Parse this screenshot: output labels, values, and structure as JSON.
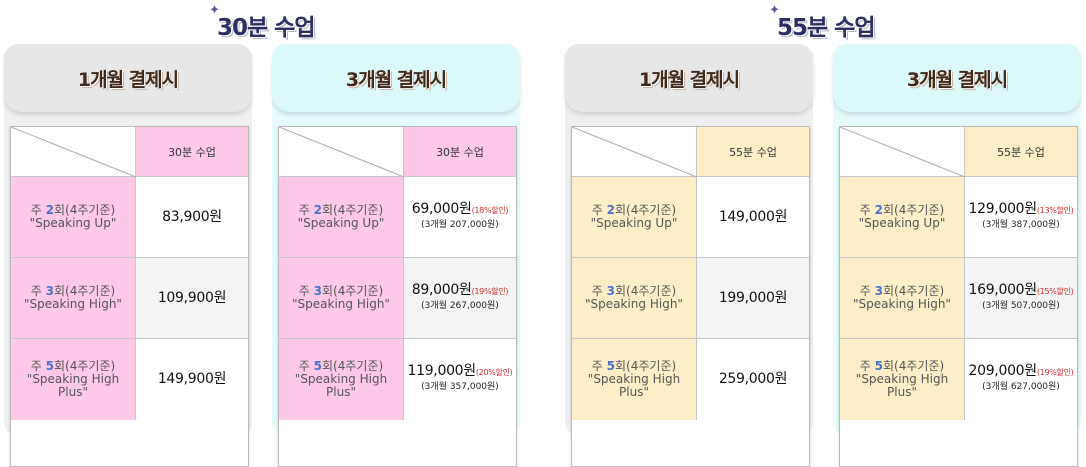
{
  "colors": {
    "title": "#2c2f62",
    "pink": "#fcc9e6",
    "yellow": "#fdeec9",
    "gray_card": "#efefef",
    "cyan_card": "#e6fbfb",
    "discount": "#d23030",
    "number": "#4a73c9"
  },
  "titles": {
    "left": "30분 수업",
    "right": "55분 수업"
  },
  "cards": [
    {
      "head": "1개월 결제시",
      "col_label": "30분 수업",
      "rows": [
        {
          "pre": "주 ",
          "num": "2",
          "post": "회(4주기준)",
          "plan": "\"Speaking Up\"",
          "price": "83,900원",
          "disc": "",
          "sub": ""
        },
        {
          "pre": "주 ",
          "num": "3",
          "post": "회(4주기준)",
          "plan": "\"Speaking High\"",
          "price": "109,900원",
          "disc": "",
          "sub": ""
        },
        {
          "pre": "주 ",
          "num": "5",
          "post": "회(4주기준)",
          "plan": "\"Speaking High Plus\"",
          "price": "149,900원",
          "disc": "",
          "sub": ""
        }
      ]
    },
    {
      "head": "3개월 결제시",
      "col_label": "30분 수업",
      "rows": [
        {
          "pre": "주 ",
          "num": "2",
          "post": "회(4주기준)",
          "plan": "\"Speaking Up\"",
          "price": "69,000원",
          "disc": "(18%할인)",
          "sub": "(3개월 207,000원)"
        },
        {
          "pre": "주 ",
          "num": "3",
          "post": "회(4주기준)",
          "plan": "\"Speaking High\"",
          "price": "89,000원",
          "disc": "(19%할인)",
          "sub": "(3개월 267,000원)"
        },
        {
          "pre": "주 ",
          "num": "5",
          "post": "회(4주기준)",
          "plan": "\"Speaking High Plus\"",
          "price": "119,000원",
          "disc": "(20%할인)",
          "sub": "(3개월 357,000원)"
        }
      ]
    },
    {
      "head": "1개월 결제시",
      "col_label": "55분 수업",
      "rows": [
        {
          "pre": "주 ",
          "num": "2",
          "post": "회(4주기준)",
          "plan": "\"Speaking Up\"",
          "price": "149,000원",
          "disc": "",
          "sub": ""
        },
        {
          "pre": "주 ",
          "num": "3",
          "post": "회(4주기준)",
          "plan": "\"Speaking High\"",
          "price": "199,000원",
          "disc": "",
          "sub": ""
        },
        {
          "pre": "주 ",
          "num": "5",
          "post": "회(4주기준)",
          "plan": "\"Speaking High Plus\"",
          "price": "259,000원",
          "disc": "",
          "sub": ""
        }
      ]
    },
    {
      "head": "3개월 결제시",
      "col_label": "55분 수업",
      "rows": [
        {
          "pre": "주 ",
          "num": "2",
          "post": "회(4주기준)",
          "plan": "\"Speaking Up\"",
          "price": "129,000원",
          "disc": "(13%할인)",
          "sub": "(3개월 387,000원)"
        },
        {
          "pre": "주 ",
          "num": "3",
          "post": "회(4주기준)",
          "plan": "\"Speaking High\"",
          "price": "169,000원",
          "disc": "(15%할인)",
          "sub": "(3개월 507,000원)"
        },
        {
          "pre": "주 ",
          "num": "5",
          "post": "회(4주기준)",
          "plan": "\"Speaking High Plus\"",
          "price": "209,000원",
          "disc": "(19%할인)",
          "sub": "(3개월 627,000원)"
        }
      ]
    }
  ]
}
